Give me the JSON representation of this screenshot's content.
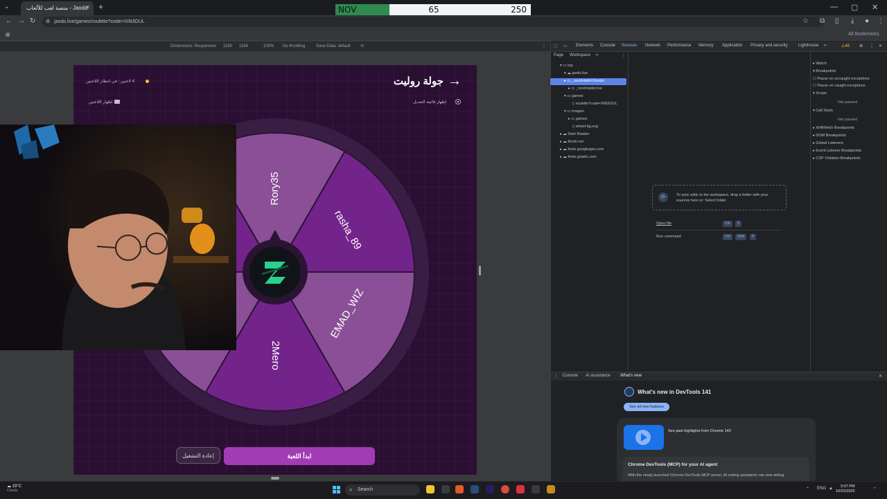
{
  "browser": {
    "tab_title": "منصة لعب للألعاب - Jaxdo",
    "url": "jaxdo.live/games/roulette?code=XIN3OUL",
    "bookmarks_right": "All Bookmarks"
  },
  "scoreboard": {
    "month": "NOV",
    "score_a": "65",
    "score_b": "250"
  },
  "device_bar": {
    "dimensions": "Dimensions: Responsive",
    "width": "1160",
    "height": "1184",
    "zoom": "100%",
    "throttle": "No throttling",
    "save_data": "Save-Data: default"
  },
  "game": {
    "title": "جولة روليت",
    "meta_count": "4 لاعبين",
    "meta_rank": "في انتظار اللاعبين",
    "settings_link": "إظهار قائمة التعديل",
    "players_link": "إظهار اللاعبين",
    "segments": [
      {
        "label": "Rory35",
        "color": "#8a4f96"
      },
      {
        "label": "rasha_89",
        "color": "#72248b"
      },
      {
        "label": "EMAD_WIZ",
        "color": "#8a4f96"
      },
      {
        "label": "2Mero",
        "color": "#72248b"
      },
      {
        "label": "",
        "color": "#8a4f96"
      },
      {
        "label": "",
        "color": "#72248b"
      }
    ],
    "reset_button": "إعادة التشغيل",
    "start_button": "ابدأ اللعبة"
  },
  "devtools": {
    "tabs": [
      "Elements",
      "Console",
      "Sources",
      "Network",
      "Performance",
      "Memory",
      "Application",
      "Privacy and security",
      "Lighthouse"
    ],
    "active_tab": "Sources",
    "issues_count": "45",
    "sub_tabs": [
      "Page",
      "Workspace"
    ],
    "tree": [
      "top",
      "jaxdo.live",
      "_next/static/chunks",
      "_next/static/css",
      "games",
      "roulette?code=XIN3OUL",
      "images",
      "games",
      "wheel-bg.svg",
      "Dark Reader",
      "fbcdn.net",
      "fonts.googleapis.com",
      "fonts.gstatic.com"
    ],
    "right_panel": [
      "Watch",
      "Breakpoints",
      "Pause on uncaught exceptions",
      "Pause on caught exceptions",
      "Scope",
      "Not paused",
      "Call Stack",
      "Not paused",
      "XHR/fetch Breakpoints",
      "DOM Breakpoints",
      "Global Listeners",
      "Event Listener Breakpoints",
      "CSP Violation Breakpoints"
    ],
    "workspace_hint": "To sync edits to the workspace, drop a folder with your sources here or: Select folder",
    "shortcut_1_label": "Open file",
    "shortcut_1_keys": [
      "Ctrl",
      "P"
    ],
    "shortcut_2_label": "Run command",
    "shortcut_2_keys": [
      "Ctrl",
      "Shift",
      "P"
    ],
    "drawer_tabs": [
      "Console",
      "AI assistance",
      "What's new"
    ],
    "whats_new_title": "What's new in DevTools 141",
    "see_all": "See all new features",
    "card_line": "See past highlights from Chrome 140",
    "card2_title": "Chrome DevTools (MCP) for your AI agent",
    "card2_text": "With the newly launched Chrome DevTools MCP server, AI coding assistants can now debug"
  },
  "taskbar": {
    "weather": "19°C",
    "weather_sub": "Cloudy",
    "search": "Search",
    "lang": "ENG",
    "time": "3:07 PM",
    "date": "10/31/2025"
  }
}
